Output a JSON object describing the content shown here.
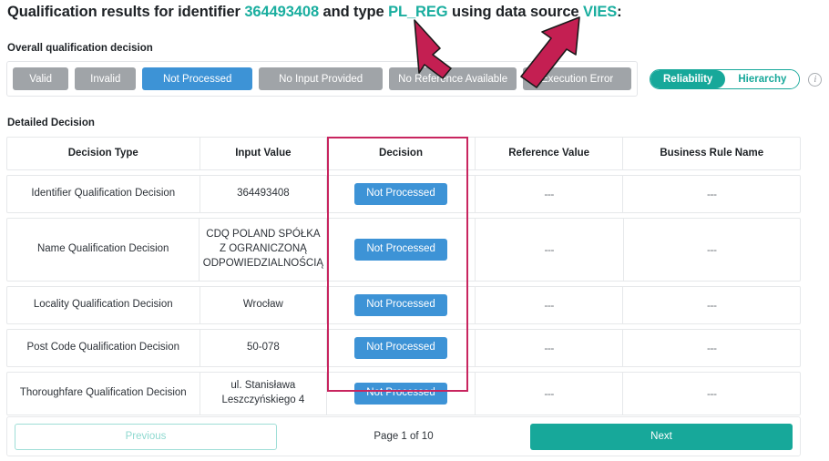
{
  "header": {
    "title_prefix": "Qualification results for identifier ",
    "identifier": "364493408",
    "title_mid": " and type ",
    "type": "PL_REG",
    "title_mid2": " using data source ",
    "source": "VIES",
    "title_suffix": ":",
    "accent_color": "#1aae9f"
  },
  "overall": {
    "label": "Overall qualification decision",
    "statuses": [
      {
        "label": "Valid",
        "active": false
      },
      {
        "label": "Invalid",
        "active": false
      },
      {
        "label": "Not Processed",
        "active": true
      },
      {
        "label": "No Input Provided",
        "active": false
      },
      {
        "label": "No Reference Available",
        "active": false
      },
      {
        "label": "Execution Error",
        "active": false
      }
    ],
    "active_color": "#3d93d6",
    "inactive_color": "#a0a4a8"
  },
  "view_toggle": {
    "options": [
      "Reliability",
      "Hierarchy"
    ],
    "selected": "Reliability",
    "info_icon": "info-icon",
    "teal": "#17a89a"
  },
  "detailed": {
    "label": "Detailed Decision",
    "columns": [
      "Decision Type",
      "Input Value",
      "Decision",
      "Reference Value",
      "Business Rule Name"
    ],
    "highlight_column": "Decision",
    "highlight_color": "#c8255f",
    "rows": [
      {
        "decision_type": "Identifier Qualification Decision",
        "input_value": "364493408",
        "decision": "Not Processed",
        "reference_value": "---",
        "business_rule_name": "---"
      },
      {
        "decision_type": "Name Qualification Decision",
        "input_value": "CDQ POLAND SPÓŁKA Z OGRANICZONĄ ODPOWIEDZIALNOŚCIĄ",
        "decision": "Not Processed",
        "reference_value": "---",
        "business_rule_name": "---"
      },
      {
        "decision_type": "Locality Qualification Decision",
        "input_value": "Wrocław",
        "decision": "Not Processed",
        "reference_value": "---",
        "business_rule_name": "---"
      },
      {
        "decision_type": "Post Code Qualification Decision",
        "input_value": "50-078",
        "decision": "Not Processed",
        "reference_value": "---",
        "business_rule_name": "---"
      },
      {
        "decision_type": "Thoroughfare Qualification Decision",
        "input_value": "ul. Stanisława Leszczyńskiego 4",
        "decision": "Not Processed",
        "reference_value": "---",
        "business_rule_name": "---"
      }
    ]
  },
  "pagination": {
    "previous_label": "Previous",
    "page_indicator": "Page 1 of 10",
    "next_label": "Next",
    "current_page": 1,
    "total_pages": 10
  },
  "annotations": {
    "color": "#c41f52",
    "arrows": [
      {
        "name": "arrow-to-type",
        "points_to": "PL_REG"
      },
      {
        "name": "arrow-to-data-source",
        "points_to": "VIES"
      }
    ]
  }
}
